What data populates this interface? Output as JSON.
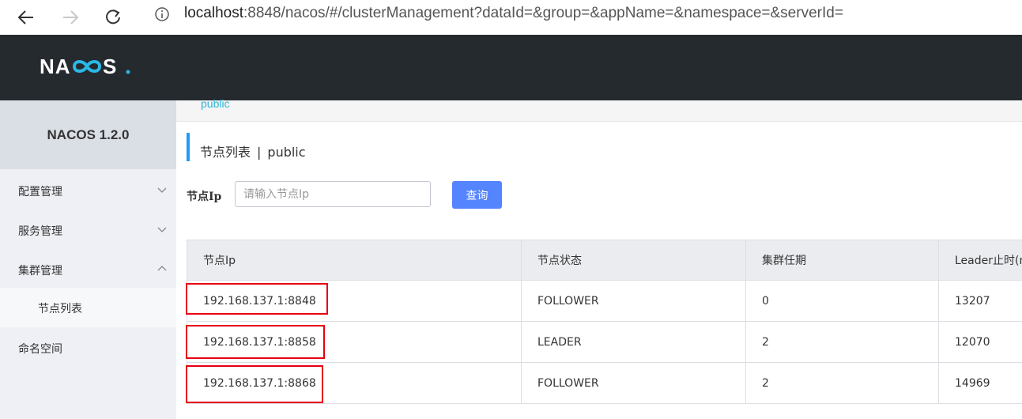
{
  "browser": {
    "url_host": "localhost",
    "url_rest": ":8848/nacos/#/clusterManagement?dataId=&group=&appName=&namespace=&serverId="
  },
  "app": {
    "logo_text": "NACOS.",
    "version": "NACOS 1.2.0",
    "namespace": "public"
  },
  "sidebar": {
    "items": [
      {
        "label": "配置管理",
        "chevron": "down"
      },
      {
        "label": "服务管理",
        "chevron": "down"
      },
      {
        "label": "集群管理",
        "chevron": "up"
      }
    ],
    "subitem": "节点列表",
    "last_item": "命名空间"
  },
  "page": {
    "title": "节点列表",
    "title_sep": "|",
    "title_ns": "public"
  },
  "search": {
    "label": "节点Ip",
    "placeholder": "请输入节点Ip",
    "button": "查询"
  },
  "table": {
    "headers": [
      "节点Ip",
      "节点状态",
      "集群任期",
      "Leader止时(m"
    ],
    "rows": [
      {
        "ip": "192.168.137.1:8848",
        "state": "FOLLOWER",
        "term": "0",
        "leader": "13207"
      },
      {
        "ip": "192.168.137.1:8858",
        "state": "LEADER",
        "term": "2",
        "leader": "12070"
      },
      {
        "ip": "192.168.137.1:8868",
        "state": "FOLLOWER",
        "term": "2",
        "leader": "14969"
      }
    ]
  },
  "colors": {
    "header_bg": "#252a2f",
    "accent": "#5584ff",
    "highlight_box": "#e60012"
  }
}
